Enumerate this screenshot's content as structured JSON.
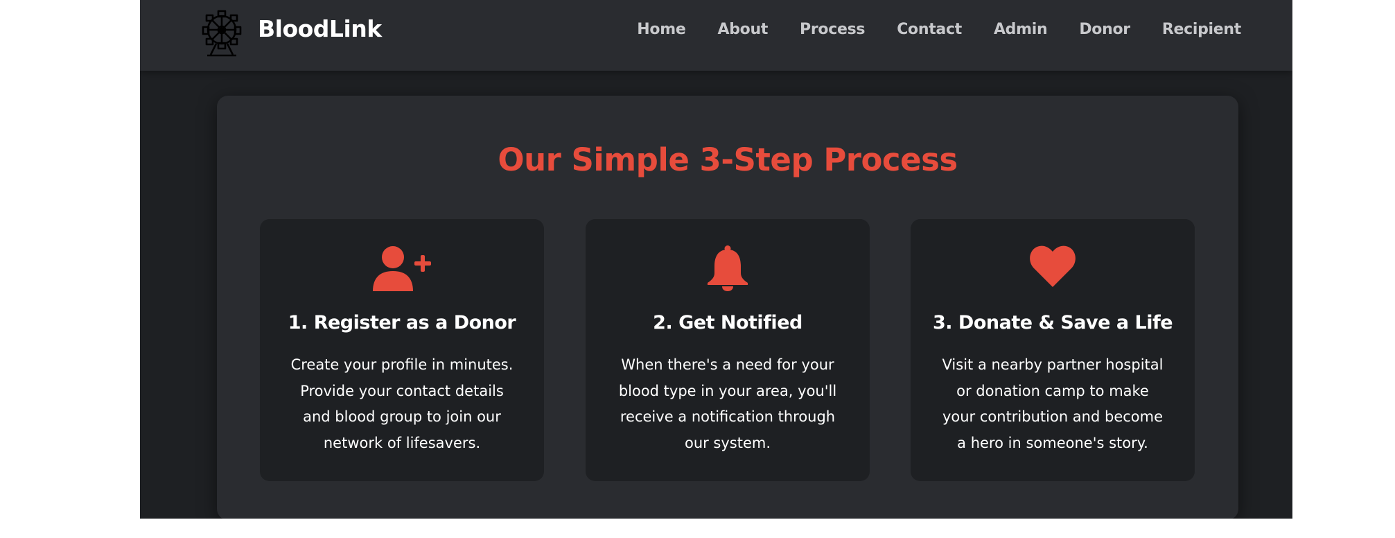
{
  "navbar": {
    "brand": "BloodLink",
    "logo_icon": "ferris-wheel-icon",
    "links": [
      "Home",
      "About",
      "Process",
      "Contact",
      "Admin",
      "Donor",
      "Recipient"
    ]
  },
  "process": {
    "title": "Our Simple 3-Step Process",
    "steps": [
      {
        "icon": "user-plus-icon",
        "title": "1. Register as a Donor",
        "description": "Create your profile in minutes. Provide your contact details and blood group to join our network of lifesavers."
      },
      {
        "icon": "bell-icon",
        "title": "2. Get Notified",
        "description": "When there's a need for your blood type in your area, you'll receive a notification through our system."
      },
      {
        "icon": "heart-icon",
        "title": "3. Donate & Save a Life",
        "description": "Visit a nearby partner hospital or donation camp to make your contribution and become a hero in someone's story."
      }
    ]
  },
  "colors": {
    "accent": "#e74c3c",
    "navbar_bg": "#2a2c30",
    "page_bg": "#1e2023",
    "panel_bg": "#2a2c30",
    "card_bg": "#1e2023",
    "nav_text": "#c8c9cc"
  }
}
